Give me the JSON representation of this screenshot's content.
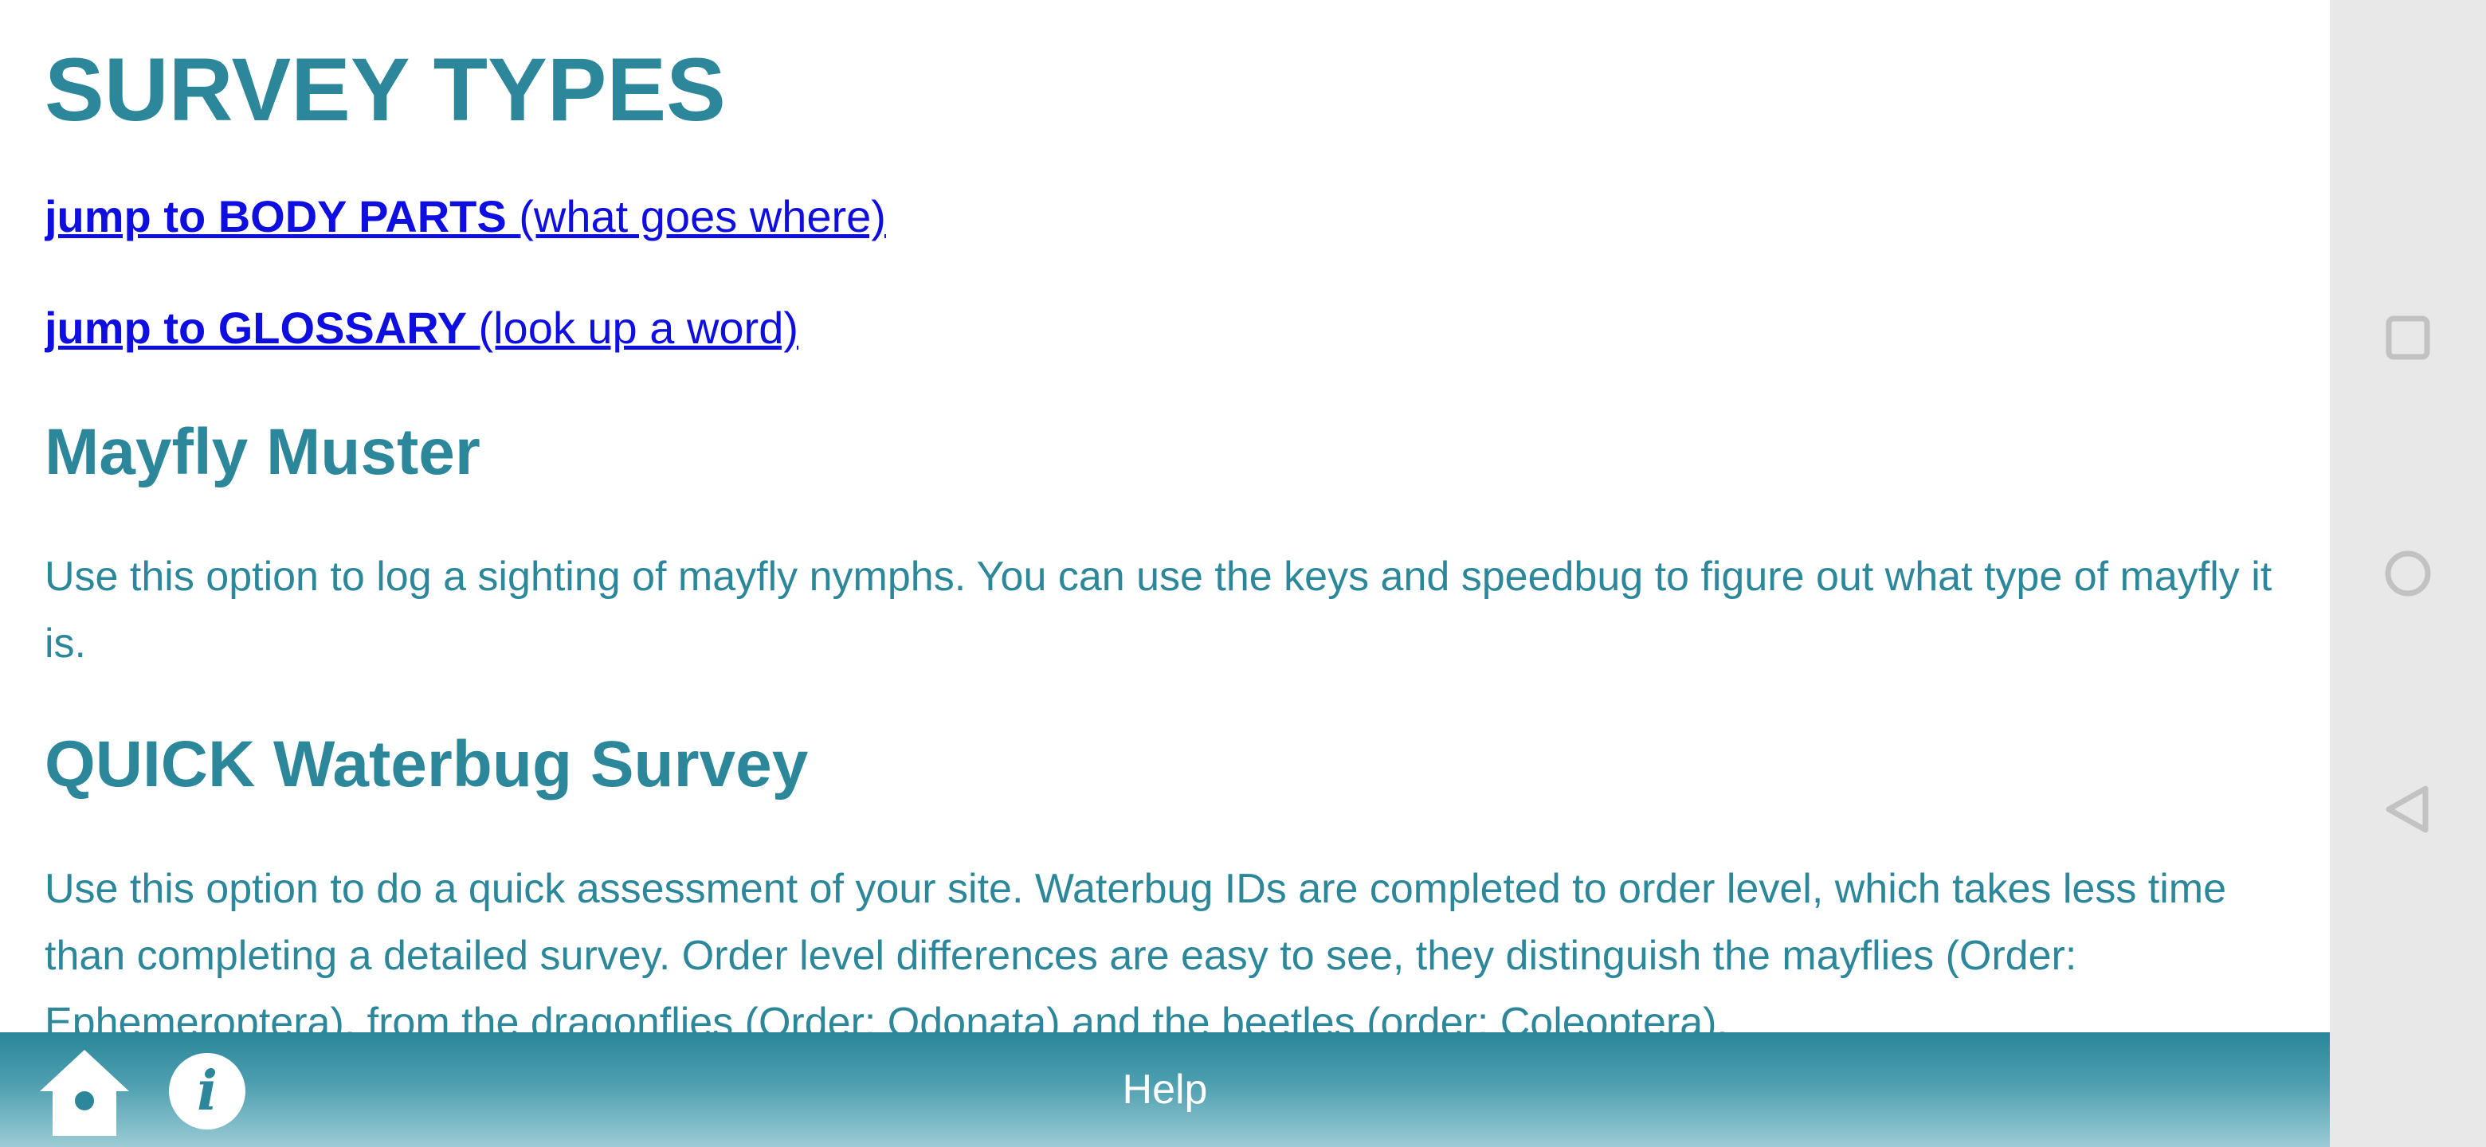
{
  "page": {
    "title": "SURVEY TYPES"
  },
  "links": [
    {
      "strong": "jump to BODY PARTS ",
      "rest": "(what goes where)"
    },
    {
      "strong": "jump to GLOSSARY ",
      "rest": "(look up a word)"
    }
  ],
  "sections": [
    {
      "heading": "Mayfly Muster",
      "text": "Use this option to log a sighting of mayfly nymphs. You can use the keys and speedbug to figure out what type of mayfly it is."
    },
    {
      "heading": "QUICK Waterbug Survey",
      "text": "Use this option to do a quick assessment of your site. Waterbug IDs are completed to order level, which takes less time than completing a detailed survey. Order level differences are easy to see, they distinguish the mayflies (Order: Ephemeroptera), from the dragonflies (Order: Odonata) and the beetles (order: Coleoptera)."
    }
  ],
  "bottom_bar": {
    "title": "Help",
    "home_icon": "home-birdhouse-icon",
    "info_icon": "info-icon",
    "info_glyph": "i"
  },
  "system_nav": {
    "recents_icon": "square-icon",
    "home_icon": "circle-icon",
    "back_icon": "triangle-back-icon"
  },
  "colors": {
    "heading": "#2b8799",
    "link": "#0e0ee0",
    "bar_top": "#2a8699",
    "bar_bottom": "#9ccbd5",
    "nav_background": "#e8e8e8",
    "nav_icon": "#c2c2c2"
  }
}
